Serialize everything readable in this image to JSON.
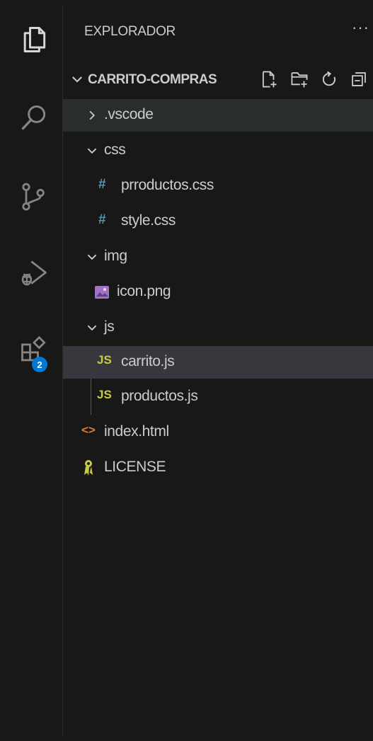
{
  "explorer": {
    "title": "EXPLORADOR",
    "more_label": "···",
    "section_title": "CARRITO-COMPRAS"
  },
  "activity_bar": {
    "extensions_badge": "2"
  },
  "tree": {
    "vscode": ".vscode",
    "css": "css",
    "prroductos_css": "prroductos.css",
    "style_css": "style.css",
    "img": "img",
    "icon_png": "icon.png",
    "js": "js",
    "carrito_js": "carrito.js",
    "productos_js": "productos.js",
    "index_html": "index.html",
    "license": "LICENSE"
  },
  "file_icons": {
    "css_hash": "#",
    "js_label": "JS",
    "html_glyph": "<>"
  },
  "colors": {
    "css_icon": "#519aba",
    "js_icon": "#cbcb41",
    "html_icon": "#e37933",
    "license_icon": "#cbcb41",
    "image_icon": "#a074c4",
    "badge": "#0078d4"
  }
}
